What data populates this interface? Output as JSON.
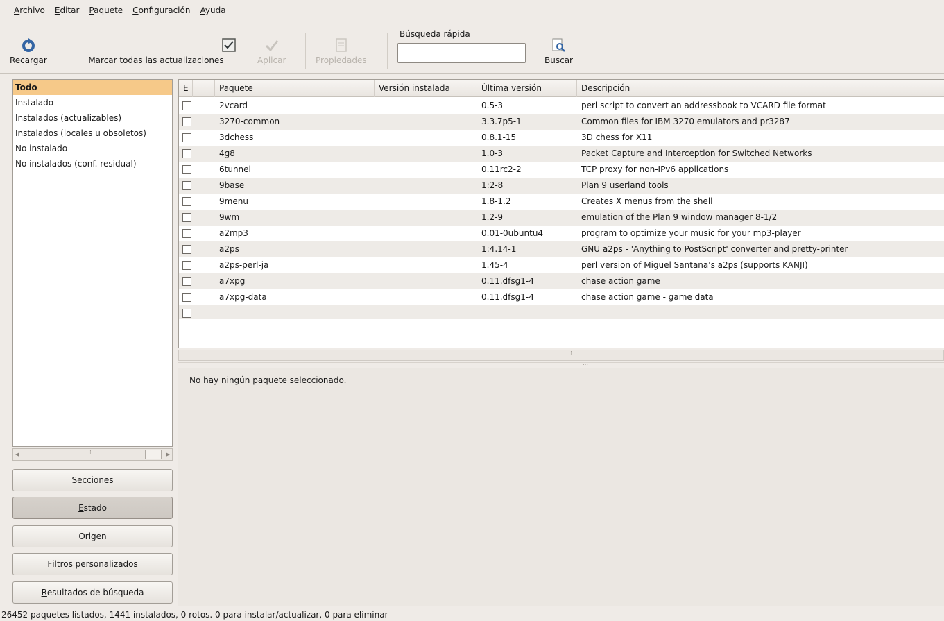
{
  "menu": [
    {
      "mnemonic": "A",
      "rest": "rchivo"
    },
    {
      "mnemonic": "E",
      "rest": "ditar"
    },
    {
      "mnemonic": "P",
      "rest": "aquete"
    },
    {
      "mnemonic": "C",
      "rest": "onfiguración"
    },
    {
      "mnemonic": "A",
      "rest": "yuda"
    }
  ],
  "toolbar": {
    "reload": "Recargar",
    "mark_all": "Marcar todas las actualizaciones",
    "apply": "Aplicar",
    "properties": "Propiedades",
    "quick_search_label": "Búsqueda rápida",
    "quick_search_value": "",
    "search": "Buscar"
  },
  "filters": {
    "selected_index": 0,
    "items": [
      "Todo",
      "Instalado",
      "Instalados (actualizables)",
      "Instalados (locales u obsoletos)",
      "No instalado",
      "No instalados (conf. residual)"
    ]
  },
  "side_buttons": {
    "sections": {
      "mnemonic": "S",
      "rest": "ecciones"
    },
    "status": {
      "mnemonic": "E",
      "rest": "stado"
    },
    "origin": {
      "mnemonic": "",
      "rest": "Origen"
    },
    "custom_filters": {
      "mnemonic": "F",
      "rest": "iltros personalizados"
    },
    "search_results": {
      "mnemonic": "R",
      "rest": "esultados de búsqueda"
    }
  },
  "table": {
    "headers": [
      "E",
      "Paquete",
      "Versión instalada",
      "Última versión",
      "Descripción"
    ],
    "rows": [
      {
        "name": "2vcard",
        "installed": "",
        "latest": "0.5-3",
        "desc": "perl script to convert an addressbook to VCARD file format"
      },
      {
        "name": "3270-common",
        "installed": "",
        "latest": "3.3.7p5-1",
        "desc": "Common files for IBM 3270 emulators and pr3287"
      },
      {
        "name": "3dchess",
        "installed": "",
        "latest": "0.8.1-15",
        "desc": "3D chess for X11"
      },
      {
        "name": "4g8",
        "installed": "",
        "latest": "1.0-3",
        "desc": "Packet Capture and Interception for Switched Networks"
      },
      {
        "name": "6tunnel",
        "installed": "",
        "latest": "0.11rc2-2",
        "desc": "TCP proxy for non-IPv6 applications"
      },
      {
        "name": "9base",
        "installed": "",
        "latest": "1:2-8",
        "desc": "Plan 9 userland tools"
      },
      {
        "name": "9menu",
        "installed": "",
        "latest": "1.8-1.2",
        "desc": "Creates X menus from the shell"
      },
      {
        "name": "9wm",
        "installed": "",
        "latest": "1.2-9",
        "desc": "emulation of the Plan 9 window manager 8-1/2"
      },
      {
        "name": "a2mp3",
        "installed": "",
        "latest": "0.01-0ubuntu4",
        "desc": "program to optimize your music for your mp3-player"
      },
      {
        "name": "a2ps",
        "installed": "",
        "latest": "1:4.14-1",
        "desc": "GNU a2ps - 'Anything to PostScript' converter and pretty-printer"
      },
      {
        "name": "a2ps-perl-ja",
        "installed": "",
        "latest": "1.45-4",
        "desc": "perl version of Miguel Santana's a2ps (supports KANJI)"
      },
      {
        "name": "a7xpg",
        "installed": "",
        "latest": "0.11.dfsg1-4",
        "desc": "chase action game"
      },
      {
        "name": "a7xpg-data",
        "installed": "",
        "latest": "0.11.dfsg1-4",
        "desc": "chase action game - game data"
      }
    ]
  },
  "details": {
    "message": "No hay ningún paquete seleccionado."
  },
  "status": "26452 paquetes listados, 1441 instalados, 0 rotos. 0 para instalar/actualizar, 0 para eliminar",
  "colors": {
    "selected_filter": "#f6c989",
    "window_bg": "#efebe7",
    "alt_row": "#eeebe7"
  },
  "icons": {
    "reload": "reload-icon",
    "mark_all": "mark-all-icon",
    "apply": "apply-check-icon",
    "properties": "properties-icon",
    "search": "search-icon"
  }
}
